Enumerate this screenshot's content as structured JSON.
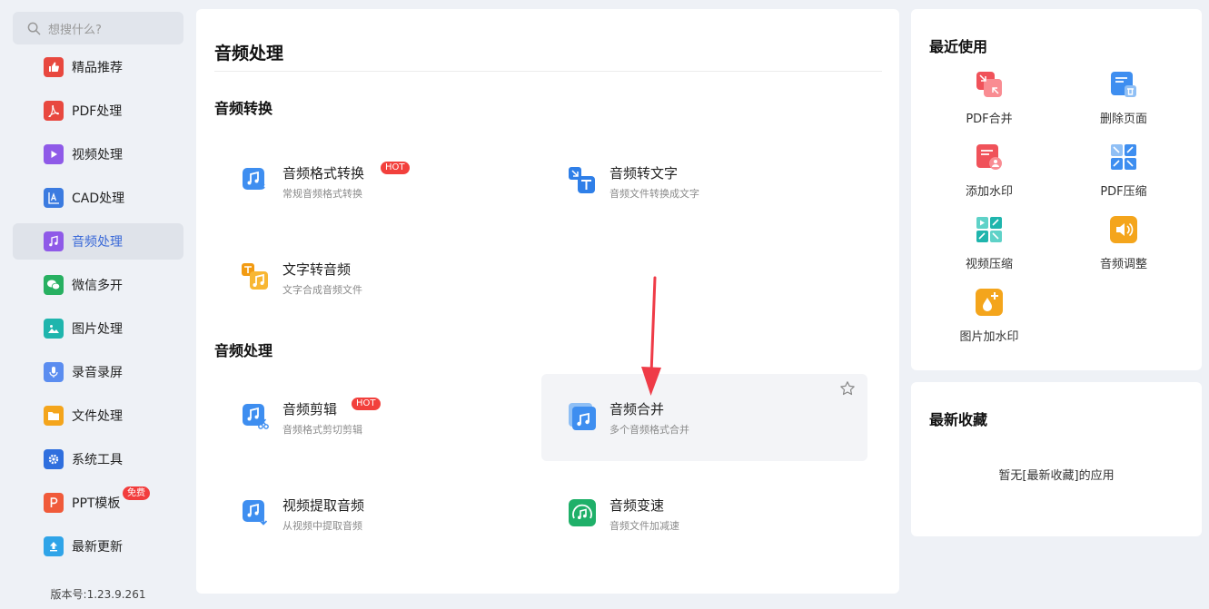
{
  "search": {
    "placeholder": "想搜什么?"
  },
  "sidebar": {
    "items": [
      {
        "label": "精品推荐",
        "icon": "thumbs-up-icon",
        "color": "#e8483f"
      },
      {
        "label": "PDF处理",
        "icon": "pdf-icon",
        "color": "#e8483f"
      },
      {
        "label": "视频处理",
        "icon": "video-play-icon",
        "color": "#8f5ae8"
      },
      {
        "label": "CAD处理",
        "icon": "cad-icon",
        "color": "#3b7be0"
      },
      {
        "label": "音频处理",
        "icon": "music-note-icon",
        "color": "#8f5ae8"
      },
      {
        "label": "微信多开",
        "icon": "wechat-icon",
        "color": "#27b061"
      },
      {
        "label": "图片处理",
        "icon": "image-icon",
        "color": "#1fb5ad"
      },
      {
        "label": "录音录屏",
        "icon": "microphone-icon",
        "color": "#5b8df0"
      },
      {
        "label": "文件处理",
        "icon": "folder-icon",
        "color": "#f4a51c"
      },
      {
        "label": "系统工具",
        "icon": "gear-icon",
        "color": "#2f6fde"
      },
      {
        "label": "PPT模板",
        "icon": "ppt-icon",
        "color": "#f05a3a",
        "badge": "免费"
      },
      {
        "label": "最新更新",
        "icon": "upload-arrow-icon",
        "color": "#2fa4e8"
      }
    ],
    "active_index": 4
  },
  "version": "版本号:1.23.9.261",
  "main": {
    "title": "音频处理",
    "sections": [
      {
        "title": "音频转换",
        "tools": [
          {
            "name": "音频格式转换",
            "desc": "常规音频格式转换",
            "icon": "audio-convert-icon",
            "hot": "HOT"
          },
          {
            "name": "音频转文字",
            "desc": "音频文件转换成文字",
            "icon": "audio-to-text-icon"
          },
          {
            "name": "文字转音频",
            "desc": "文字合成音频文件",
            "icon": "text-to-audio-icon"
          }
        ]
      },
      {
        "title": "音频处理",
        "tools": [
          {
            "name": "音频剪辑",
            "desc": "音频格式剪切剪辑",
            "icon": "audio-cut-icon",
            "hot": "HOT"
          },
          {
            "name": "音频合并",
            "desc": "多个音频格式合并",
            "icon": "audio-merge-icon"
          },
          {
            "name": "视频提取音频",
            "desc": "从视频中提取音频",
            "icon": "video-extract-audio-icon"
          },
          {
            "name": "音频变速",
            "desc": "音频文件加减速",
            "icon": "audio-speed-icon"
          }
        ]
      }
    ]
  },
  "recent": {
    "title": "最近使用",
    "items": [
      {
        "name": "PDF合并",
        "icon": "pdf-merge-icon"
      },
      {
        "name": "删除页面",
        "icon": "delete-page-icon"
      },
      {
        "name": "添加水印",
        "icon": "add-watermark-icon"
      },
      {
        "name": "PDF压缩",
        "icon": "pdf-compress-icon"
      },
      {
        "name": "视频压缩",
        "icon": "video-compress-icon"
      },
      {
        "name": "音频调整",
        "icon": "audio-adjust-icon"
      },
      {
        "name": "图片加水印",
        "icon": "image-watermark-icon"
      }
    ]
  },
  "favorites": {
    "title": "最新收藏",
    "empty": "暂无[最新收藏]的应用"
  },
  "colors": {
    "accent": "#3a69d8",
    "hot": "#f2403c",
    "page_bg": "#eef1f6",
    "active_bg": "#dfe3ea"
  }
}
